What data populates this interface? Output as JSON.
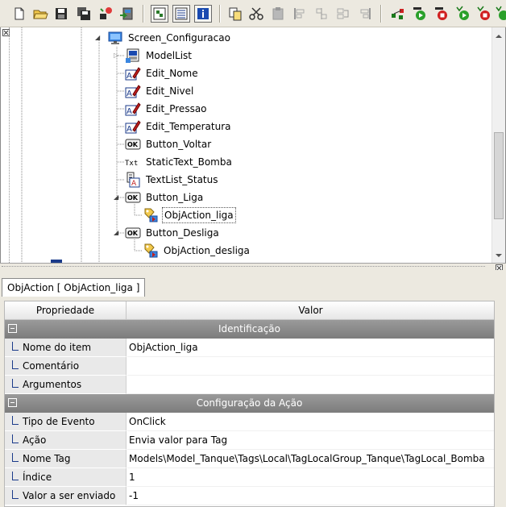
{
  "toolbar": {
    "buttons": [
      "new-icon",
      "open-icon",
      "save-icon",
      "save-all-icon",
      "build-icon",
      "deploy-icon",
      "view-tree-icon",
      "view-list-icon",
      "info-icon",
      "copy-icon",
      "cut-icon",
      "paste-icon",
      "align-left-icon",
      "align-center-icon",
      "align-right-icon",
      "align-top-icon",
      "debug-icon",
      "run-icon",
      "stop-icon",
      "run-verify-icon",
      "stop-verify-icon",
      "run-step-icon"
    ]
  },
  "tree": {
    "nodes": [
      {
        "label": "Screen_Configuracao",
        "icon": "screen-icon"
      },
      {
        "label": "ModelList",
        "icon": "modellist-icon"
      },
      {
        "label": "Edit_Nome",
        "icon": "edit-field-icon"
      },
      {
        "label": "Edit_Nivel",
        "icon": "edit-field-icon"
      },
      {
        "label": "Edit_Pressao",
        "icon": "edit-field-icon"
      },
      {
        "label": "Edit_Temperatura",
        "icon": "edit-field-icon"
      },
      {
        "label": "Button_Voltar",
        "icon": "ok-button-icon",
        "badge": "OK"
      },
      {
        "label": "StaticText_Bomba",
        "icon": "static-text-icon",
        "badge": "Txt"
      },
      {
        "label": "TextList_Status",
        "icon": "text-list-icon"
      },
      {
        "label": "Button_Liga",
        "icon": "ok-button-icon",
        "badge": "OK"
      },
      {
        "label": "ObjAction_liga",
        "icon": "obj-action-icon"
      },
      {
        "label": "Button_Desliga",
        "icon": "ok-button-icon",
        "badge": "OK"
      },
      {
        "label": "ObjAction_desliga",
        "icon": "obj-action-icon"
      }
    ]
  },
  "properties": {
    "tab_label": "ObjAction [ ObjAction_liga ]",
    "header": {
      "col1": "Propriedade",
      "col2": "Valor"
    },
    "groups": [
      {
        "title": "Identificação",
        "rows": [
          {
            "name": "Nome do item",
            "value": "ObjAction_liga"
          },
          {
            "name": "Comentário",
            "value": ""
          },
          {
            "name": "Argumentos",
            "value": ""
          }
        ]
      },
      {
        "title": "Configuração da Ação",
        "rows": [
          {
            "name": "Tipo de Evento",
            "value": "OnClick"
          },
          {
            "name": "Ação",
            "value": "Envia valor para Tag"
          },
          {
            "name": "Nome Tag",
            "value": "Models\\Model_Tanque\\Tags\\Local\\TagLocalGroup_Tanque\\TagLocal_Bomba"
          },
          {
            "name": "Índice",
            "value": "1"
          },
          {
            "name": "Valor a ser enviado",
            "value": "-1"
          }
        ]
      }
    ]
  },
  "colors": {
    "group_header": "#8a8a8a",
    "toolbar_bg": "#ece9e0",
    "name_cell": "#e9e9e9",
    "tick_line": "#1a3a8a"
  }
}
